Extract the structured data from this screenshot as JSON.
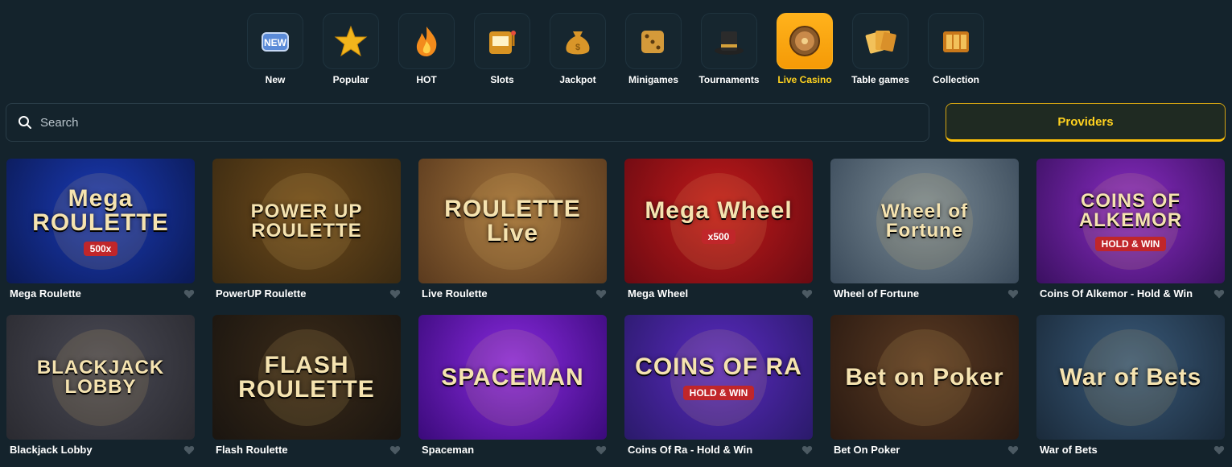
{
  "categories": [
    {
      "label": "New",
      "icon": "new-badge-icon",
      "active": false
    },
    {
      "label": "Popular",
      "icon": "star-icon",
      "active": false
    },
    {
      "label": "HOT",
      "icon": "flame-icon",
      "active": false
    },
    {
      "label": "Slots",
      "icon": "slot-machine-icon",
      "active": false
    },
    {
      "label": "Jackpot",
      "icon": "money-bag-icon",
      "active": false
    },
    {
      "label": "Minigames",
      "icon": "dice-icon",
      "active": false
    },
    {
      "label": "Tournaments",
      "icon": "top-hat-icon",
      "active": false
    },
    {
      "label": "Live Casino",
      "icon": "roulette-wheel-icon",
      "active": true
    },
    {
      "label": "Table games",
      "icon": "playing-cards-icon",
      "active": false
    },
    {
      "label": "Collection",
      "icon": "collection-slots-icon",
      "active": false
    }
  ],
  "search": {
    "placeholder": "Search",
    "value": ""
  },
  "providers_label": "Providers",
  "games": [
    {
      "name": "Mega Roulette",
      "art": "Mega ROULETTE",
      "badge": "500x",
      "colors": [
        "#0b1a55",
        "#1a3ab5"
      ]
    },
    {
      "name": "PowerUP Roulette",
      "art": "POWER UP ROULETTE",
      "badge": "",
      "colors": [
        "#3a2a12",
        "#6e4a1a"
      ]
    },
    {
      "name": "Live Roulette",
      "art": "ROULETTE Live",
      "badge": "",
      "colors": [
        "#5a3a1e",
        "#a0713a"
      ]
    },
    {
      "name": "Mega Wheel",
      "art": "Mega Wheel",
      "badge": "x500",
      "colors": [
        "#6a0a12",
        "#c21a1a"
      ]
    },
    {
      "name": "Wheel of Fortune",
      "art": "Wheel of Fortune",
      "badge": "",
      "colors": [
        "#3a4a5a",
        "#7a8a95"
      ]
    },
    {
      "name": "Coins Of Alkemor - Hold & Win",
      "art": "COINS OF ALKEMOR",
      "badge": "HOLD & WIN",
      "colors": [
        "#3a1060",
        "#8a2cc4"
      ]
    },
    {
      "name": "Blackjack Lobby",
      "art": "BLACKJACK LOBBY",
      "badge": "",
      "colors": [
        "#2a2a30",
        "#4a4a55"
      ]
    },
    {
      "name": "Flash Roulette",
      "art": "FLASH ROULETTE",
      "badge": "",
      "colors": [
        "#1a1510",
        "#3a2a18"
      ]
    },
    {
      "name": "Spaceman",
      "art": "SPACEMAN",
      "badge": "",
      "colors": [
        "#3a0a7a",
        "#8a2ae0"
      ]
    },
    {
      "name": "Coins Of Ra - Hold & Win",
      "art": "COINS OF RA",
      "badge": "HOLD & WIN",
      "colors": [
        "#2a1a6a",
        "#5a2ac0"
      ]
    },
    {
      "name": "Bet On Poker",
      "art": "Bet on Poker",
      "badge": "",
      "colors": [
        "#2a1a12",
        "#5a3a22"
      ]
    },
    {
      "name": "War of Bets",
      "art": "War of Bets",
      "badge": "",
      "colors": [
        "#1a2a3a",
        "#3a5a7a"
      ]
    }
  ],
  "colors": {
    "accent": "#ffd21f",
    "active_tile": "#ffb21c",
    "background": "#14232c"
  }
}
